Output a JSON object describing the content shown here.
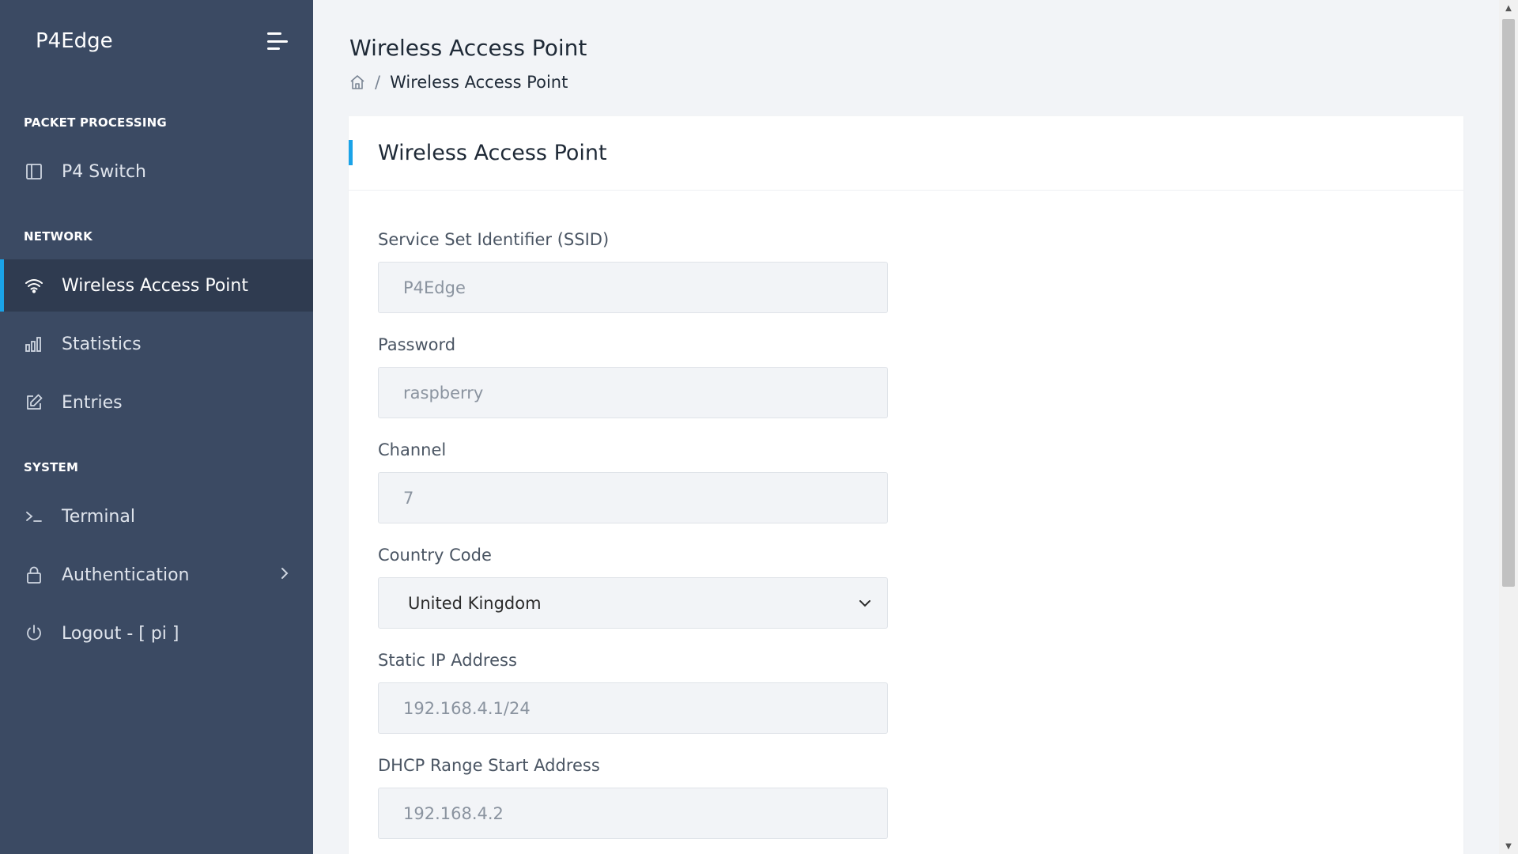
{
  "sidebar": {
    "brand": "P4Edge",
    "sections": {
      "packet_processing": "PACKET PROCESSING",
      "network": "NETWORK",
      "system": "SYSTEM"
    },
    "items": {
      "p4_switch": "P4 Switch",
      "wireless_access_point": "Wireless Access Point",
      "statistics": "Statistics",
      "entries": "Entries",
      "terminal": "Terminal",
      "authentication": "Authentication",
      "logout": "Logout - [ pi ]"
    }
  },
  "header": {
    "title": "Wireless Access Point",
    "breadcrumb_current": "Wireless Access Point",
    "breadcrumb_separator": "/"
  },
  "card": {
    "title": "Wireless Access Point"
  },
  "form": {
    "ssid": {
      "label": "Service Set Identifier (SSID)",
      "placeholder": "P4Edge"
    },
    "password": {
      "label": "Password",
      "placeholder": "raspberry"
    },
    "channel": {
      "label": "Channel",
      "placeholder": "7"
    },
    "country_code": {
      "label": "Country Code",
      "value": "United Kingdom"
    },
    "static_ip": {
      "label": "Static IP Address",
      "placeholder": "192.168.4.1/24"
    },
    "dhcp_start": {
      "label": "DHCP Range Start Address",
      "placeholder": "192.168.4.2"
    }
  },
  "colors": {
    "sidebar_bg": "#3b4a63",
    "accent": "#1aa3e8"
  }
}
